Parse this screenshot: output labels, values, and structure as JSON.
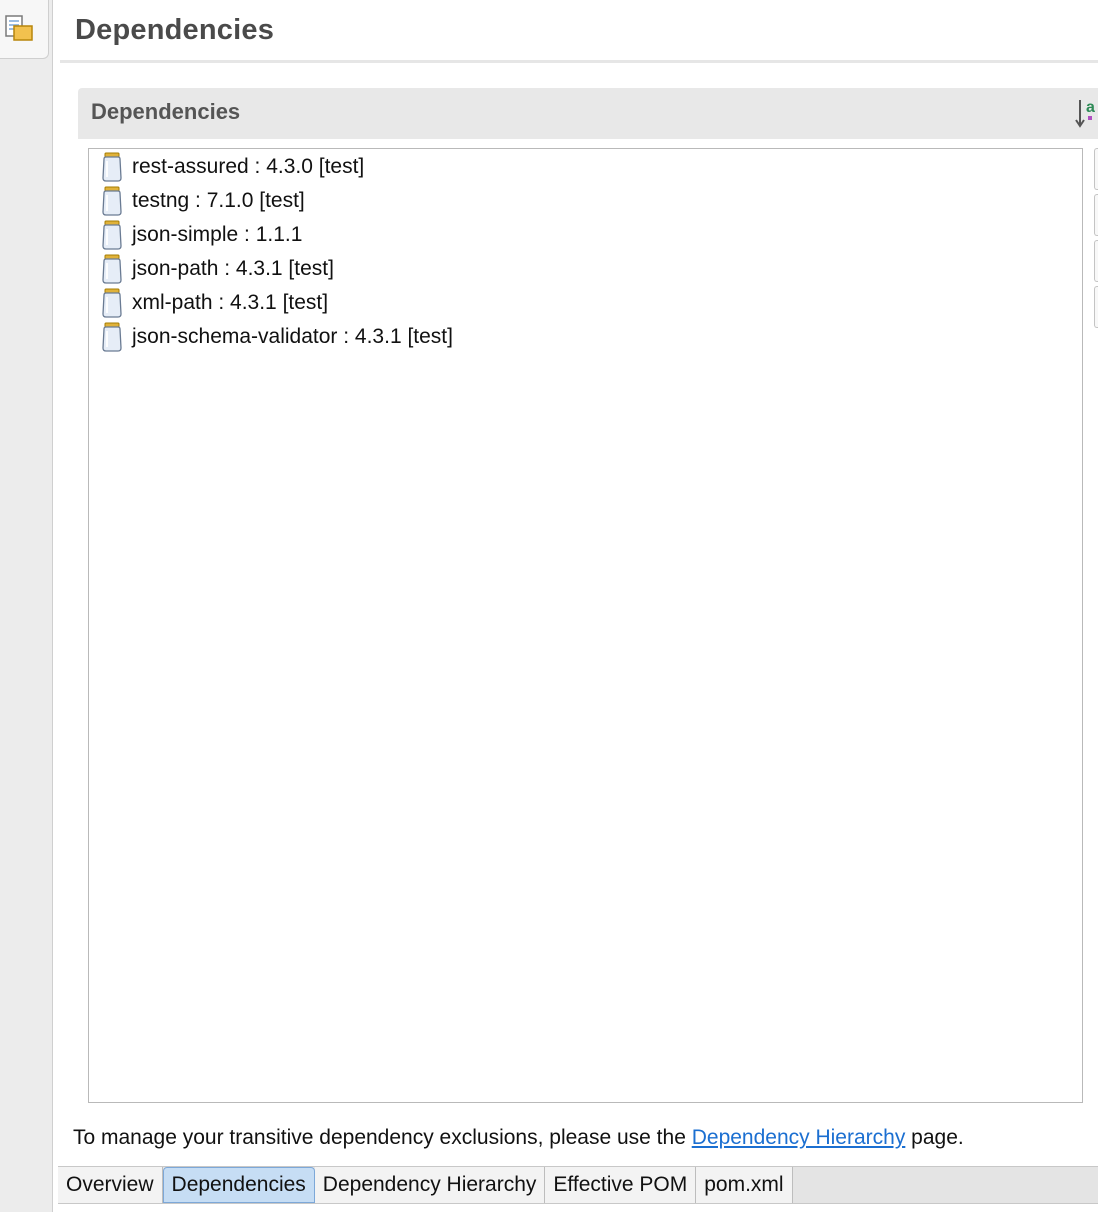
{
  "page": {
    "title": "Dependencies"
  },
  "section": {
    "title": "Dependencies",
    "sort_icon": "sort-alphabetical-icon"
  },
  "dependencies": [
    {
      "label": "rest-assured : 4.3.0 [test]",
      "icon": "jar-icon"
    },
    {
      "label": "testng : 7.1.0 [test]",
      "icon": "jar-icon"
    },
    {
      "label": "json-simple : 1.1.1",
      "icon": "jar-icon"
    },
    {
      "label": "json-path : 4.3.1 [test]",
      "icon": "jar-icon"
    },
    {
      "label": "xml-path : 4.3.1 [test]",
      "icon": "jar-icon"
    },
    {
      "label": "json-schema-validator : 4.3.1 [test]",
      "icon": "jar-icon"
    }
  ],
  "info": {
    "prefix": "To manage your transitive dependency exclusions, please use the ",
    "link": "Dependency Hierarchy",
    "suffix": " page."
  },
  "tabs": [
    {
      "label": "Overview",
      "active": false
    },
    {
      "label": "Dependencies",
      "active": true
    },
    {
      "label": "Dependency Hierarchy",
      "active": false
    },
    {
      "label": "Effective POM",
      "active": false
    },
    {
      "label": "pom.xml",
      "active": false
    }
  ],
  "colors": {
    "link": "#1b6fd1",
    "active_tab": "#c6ddf4",
    "jar_lid": "#e0b23a"
  }
}
